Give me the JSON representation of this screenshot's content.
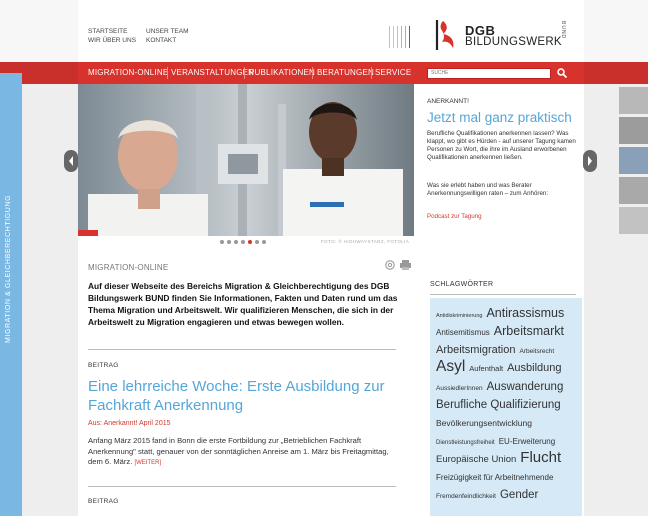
{
  "header": {
    "top_links": [
      "STARTSEITE",
      "UNSER TEAM",
      "WIR ÜBER UNS",
      "KONTAKT"
    ],
    "logo_line1": "DGB",
    "logo_line2": "BILDUNGSWERK",
    "logo_side": "BUND",
    "brand_color": "#d7322b"
  },
  "nav": {
    "items": [
      "MIGRATION-ONLINE",
      "VERANSTALTUNGEN",
      "PUBLIKATIONEN",
      "BERATUNGEN",
      "SERVICE"
    ],
    "search_placeholder": "SUCHE"
  },
  "side_tab": {
    "label": "MIGRATION & GLEICHBERECHTIGUNG",
    "color": "#7ab7e2"
  },
  "hero": {
    "kicker": "ANERKANNT!",
    "title": "Jetzt mal ganz praktisch",
    "text1": "Berufliche Qualifikationen anerkennen lassen? Was klappt, wo gibt es Hürden - auf unserer Tagung kamen Personen zu Wort, die ihre im Ausland erworbenen Qualifikationen anerkennen ließen.",
    "text2": "Was sie erlebt haben und was Berater Anerkennungswilligen raten – zum Anhören:",
    "link": "Podcast zur Tagung",
    "credit": "FOTO: © HIGHWAYSTARZ, FOTOLIA",
    "slide_count": 7,
    "active_slide": 4
  },
  "main": {
    "section_label": "MIGRATION-ONLINE",
    "intro": "Auf dieser Webseite des Bereichs Migration & Gleichberechtigung des DGB Bildungswerk BUND finden Sie Informationen, Fakten und Daten rund um das Thema Migration und Arbeitswelt. Wir qualifizieren Menschen, die sich in der Arbeitswelt zu Migration engagieren und etwas bewegen wollen.",
    "post1": {
      "kind": "BEITRAG",
      "title": "Eine lehrreiche Woche: Erste Ausbildung zur Fachkraft Anerkennung",
      "meta": "Aus: Anerkannt! April 2015",
      "body": "Anfang März 2015 fand in Bonn die erste Fortbildung zur „Betrieblichen Fachkraft Anerkennung\" statt, genauer von der sonntäglichen Anreise am 1. März bis Freitagmittag, dem 6. März.",
      "more": "[WEITER]"
    },
    "post2": {
      "kind": "BEITRAG"
    }
  },
  "schlagwoerter": {
    "heading": "SCHLAGWÖRTER",
    "tags": [
      {
        "label": "Antidiskriminierung",
        "size": 5.5
      },
      {
        "label": "Antirassismus",
        "size": 12.5
      },
      {
        "label": "Antisemitismus",
        "size": 8
      },
      {
        "label": "Arbeitsmarkt",
        "size": 12.5
      },
      {
        "label": "Arbeitsmigration",
        "size": 11
      },
      {
        "label": "Arbeitsrecht",
        "size": 6.5
      },
      {
        "label": "Asyl",
        "size": 15.5
      },
      {
        "label": "Aufenthalt",
        "size": 7.5
      },
      {
        "label": "Ausbildung",
        "size": 11
      },
      {
        "label": "AussiedlerInnen",
        "size": 6.5
      },
      {
        "label": "Auswanderung",
        "size": 11.5
      },
      {
        "label": "Berufliche Qualifizierung",
        "size": 11.5
      },
      {
        "label": "Bevölkerungsentwicklung",
        "size": 8.5
      },
      {
        "label": "Dienstleistungsfreiheit",
        "size": 6
      },
      {
        "label": "EU-Erweiterung",
        "size": 8
      },
      {
        "label": "Europäische Union",
        "size": 9.5
      },
      {
        "label": "Flucht",
        "size": 15
      },
      {
        "label": "Freizügigkeit für Arbeitnehmende",
        "size": 8
      },
      {
        "label": "Fremdenfeindlichkeit",
        "size": 6.5
      },
      {
        "label": "Gender",
        "size": 11.5
      }
    ]
  }
}
